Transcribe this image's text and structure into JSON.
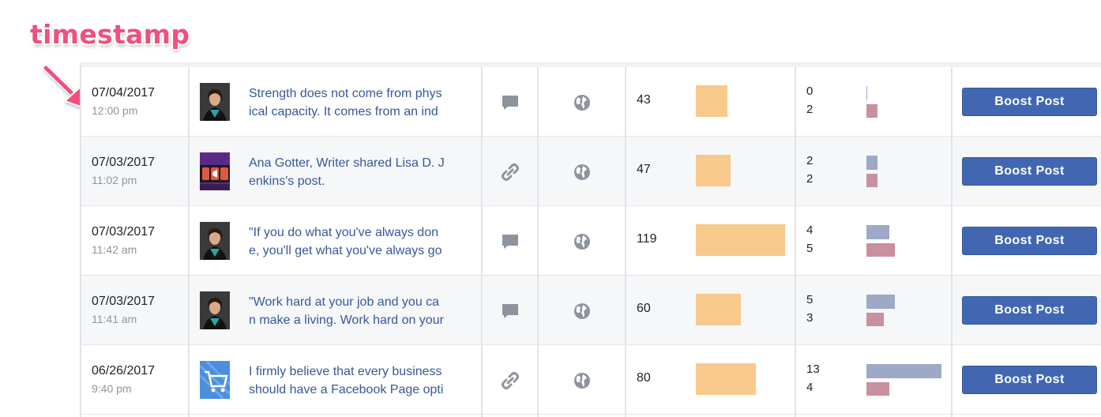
{
  "annotation": {
    "label": "timestamp",
    "color": "#f0507e"
  },
  "colors": {
    "reach_bar": "#f7c98b",
    "engagement_bar_top": "#9ea9c8",
    "engagement_bar_bottom": "#c9909f",
    "boost_button": "#4267b2",
    "post_link": "#365899"
  },
  "posts": [
    {
      "date": "07/04/2017",
      "time": "12:00 pm",
      "thumb_icon": "profile-photo",
      "text_line1": "Strength does not come from phys",
      "text_line2": "ical capacity. It comes from an ind",
      "type_icon": "status-icon",
      "privacy_icon": "globe-icon",
      "reach": "43",
      "eng_top": "0",
      "eng_bottom": "2",
      "boost_label": "Boost Post"
    },
    {
      "date": "07/03/2017",
      "time": "11:02 pm",
      "thumb_icon": "megaphone-image",
      "text_line1": "Ana Gotter, Writer shared Lisa D. J",
      "text_line2": "enkins's post.",
      "type_icon": "link-icon",
      "privacy_icon": "globe-icon",
      "reach": "47",
      "eng_top": "2",
      "eng_bottom": "2",
      "boost_label": "Boost Post"
    },
    {
      "date": "07/03/2017",
      "time": "11:42 am",
      "thumb_icon": "profile-photo",
      "text_line1": "\"If you do what you've always don",
      "text_line2": "e, you'll get what you've always go",
      "type_icon": "status-icon",
      "privacy_icon": "globe-icon",
      "reach": "119",
      "eng_top": "4",
      "eng_bottom": "5",
      "boost_label": "Boost Post"
    },
    {
      "date": "07/03/2017",
      "time": "11:41 am",
      "thumb_icon": "profile-photo",
      "text_line1": "\"Work hard at your job and you ca",
      "text_line2": "n make a living. Work hard on your",
      "type_icon": "status-icon",
      "privacy_icon": "globe-icon",
      "reach": "60",
      "eng_top": "5",
      "eng_bottom": "3",
      "boost_label": "Boost Post"
    },
    {
      "date": "06/26/2017",
      "time": "9:40 pm",
      "thumb_icon": "shopping-cart-image",
      "text_line1": "I firmly believe that every business",
      "text_line2": "should have a Facebook Page opti",
      "type_icon": "link-icon",
      "privacy_icon": "globe-icon",
      "reach": "80",
      "eng_top": "13",
      "eng_bottom": "4",
      "boost_label": "Boost Post"
    }
  ]
}
